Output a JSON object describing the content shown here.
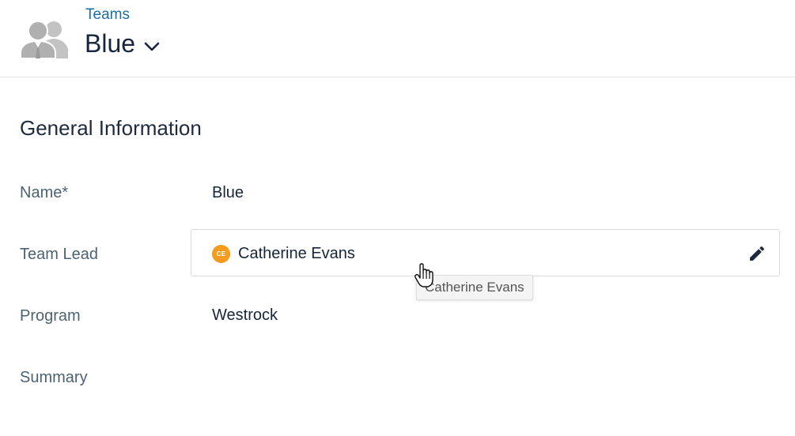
{
  "header": {
    "breadcrumb": "Teams",
    "title": "Blue",
    "avatar_icon": "team-people-icon",
    "dropdown_icon": "chevron-down-icon"
  },
  "section": {
    "title": "General Information"
  },
  "fields": {
    "name": {
      "label": "Name*",
      "value": "Blue"
    },
    "team_lead": {
      "label": "Team Lead",
      "value": "Catherine Evans",
      "initials": "CE",
      "badge_color": "#f39c1f",
      "edit_icon": "pencil-icon"
    },
    "program": {
      "label": "Program",
      "value": "Westrock"
    },
    "summary": {
      "label": "Summary",
      "value": ""
    }
  },
  "tooltip": {
    "text": "Catherine Evans"
  },
  "colors": {
    "link": "#1a6ea8",
    "title": "#15253d",
    "label": "#4d6272"
  }
}
